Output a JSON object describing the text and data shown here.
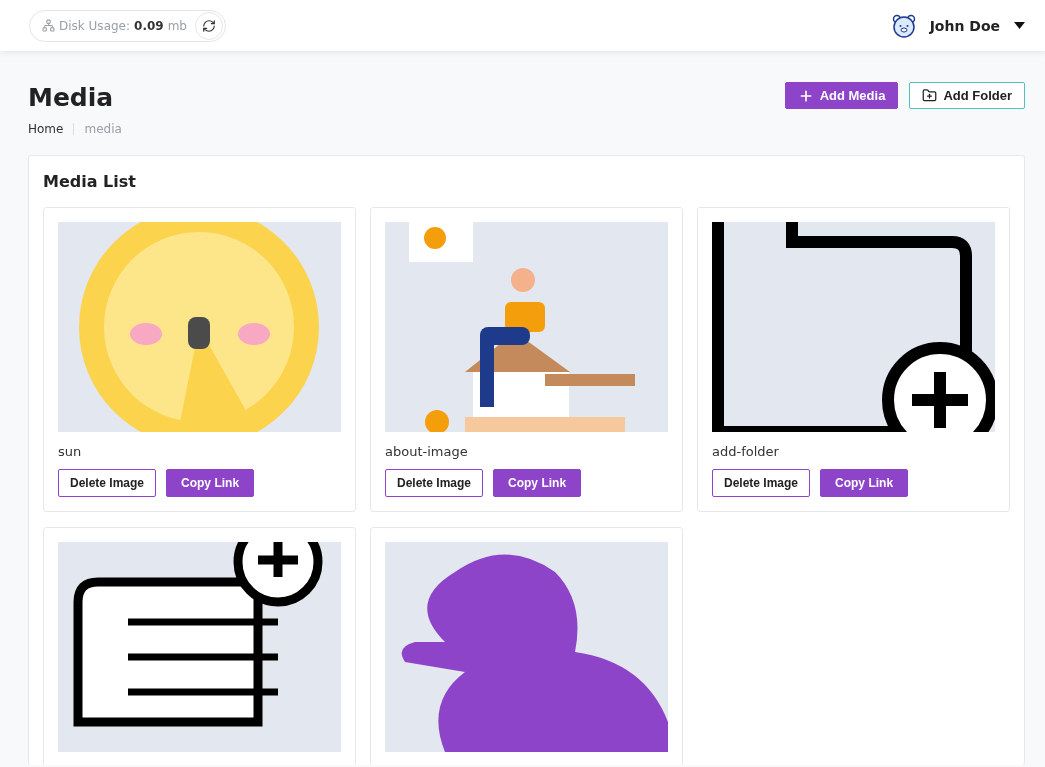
{
  "topbar": {
    "disk_label": "Disk Usage:",
    "disk_value": "0.09",
    "disk_unit": "mb",
    "user": "John Doe"
  },
  "page": {
    "title": "Media",
    "breadcrumb": [
      "Home",
      "media"
    ],
    "actions": [
      {
        "kind": "primary",
        "label": "Add Media"
      },
      {
        "kind": "outline",
        "label": "Add Folder"
      }
    ]
  },
  "media_list": {
    "title": "Media List",
    "items": [
      {
        "kind": "picture",
        "name": "sun",
        "actions": [
          "Delete Image",
          "Copy Link"
        ]
      },
      {
        "kind": "picture",
        "name": "about-image",
        "actions": [
          "Delete Image",
          "Copy Link"
        ]
      },
      {
        "kind": "picture",
        "name": "add-folder",
        "actions": [
          "Delete Image",
          "Copy Link"
        ]
      },
      {
        "kind": "picture"
      },
      {
        "kind": "picture"
      }
    ]
  }
}
